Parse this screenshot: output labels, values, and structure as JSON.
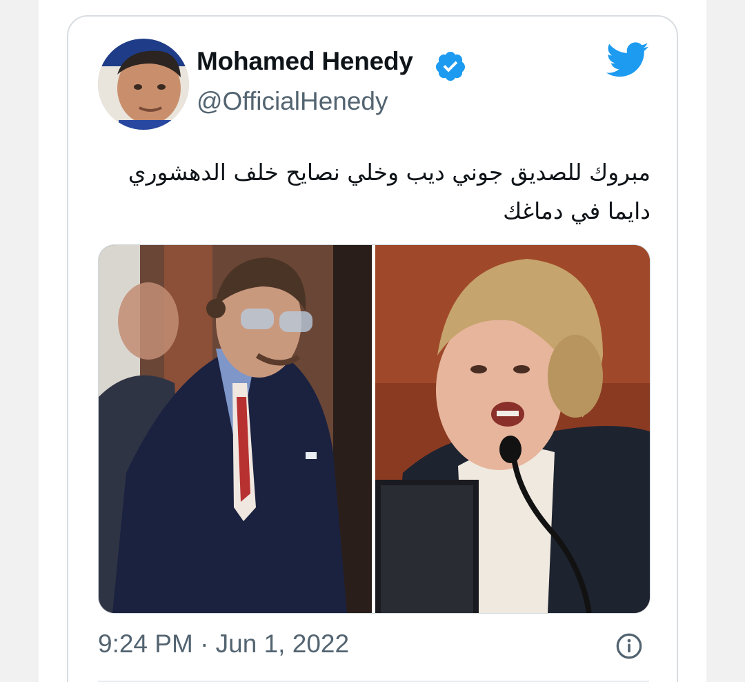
{
  "tweet": {
    "author_name": "Mohamed Henedy",
    "author_handle": "@OfficialHenedy",
    "verified": true,
    "text": "مبروك للصديق جوني ديب وخلي نصايح خلف الدهشوري دايما في دماغك",
    "timestamp": "9:24 PM · Jun 1, 2022",
    "media_count": 2
  },
  "icons": {
    "brand": "twitter-bird-icon",
    "verified": "verified-badge-icon",
    "info": "info-icon"
  },
  "colors": {
    "twitter_blue": "#1d9bf0",
    "text_primary": "#0f1419",
    "text_secondary": "#536471",
    "card_border": "#d9dde1"
  }
}
